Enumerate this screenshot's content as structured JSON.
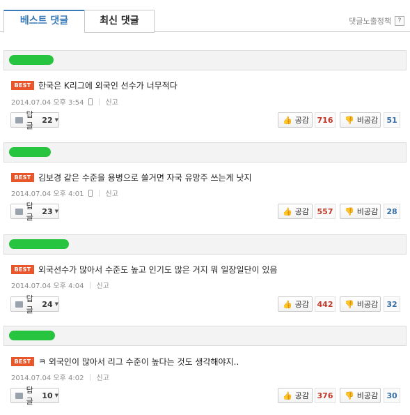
{
  "tabs": {
    "best_label": "베스트 댓글",
    "latest_label": "최신 댓글"
  },
  "policy": {
    "label": "댓글노출정책",
    "help": "?"
  },
  "labels": {
    "best_badge": "BEST",
    "reply": "답글",
    "report": "신고",
    "like": "공감",
    "dislike": "비공감",
    "caret": "▼"
  },
  "comments": [
    {
      "text": "한국은 K리그에 외국인 선수가 너무적다",
      "date": "2014.07.04 오후 3:54",
      "mobile": true,
      "replies": "22",
      "likes": "716",
      "dislikes": "51"
    },
    {
      "text": "김보경 같은 수준을 용병으로 쓸거면 자국 유망주 쓰는게 낫지",
      "date": "2014.07.04 오후 4:01",
      "mobile": true,
      "replies": "23",
      "likes": "557",
      "dislikes": "28"
    },
    {
      "text": "외국선수가 많아서 수준도 높고 인기도 많은 거지 뭐 일장일단이 있음",
      "date": "2014.07.04 오후 4:04",
      "mobile": false,
      "replies": "24",
      "likes": "442",
      "dislikes": "32"
    },
    {
      "text": "ㅋ 외국인이 많아서 리그 수준이 높다는 것도 생각해야지..",
      "date": "2014.07.04 오후 4:02",
      "mobile": false,
      "replies": "10",
      "likes": "376",
      "dislikes": "30"
    }
  ],
  "colors": {
    "best_badge": "#e8562a",
    "active_tab": "#3b7bb8",
    "like_count": "#c0392b",
    "dislike_count": "#3a6fa5",
    "username_redaction": "#27c43f"
  }
}
